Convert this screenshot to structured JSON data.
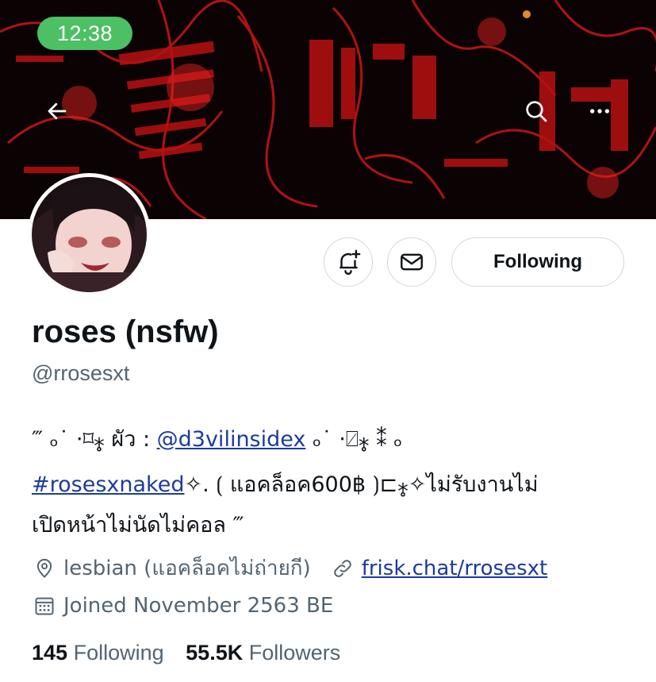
{
  "status_bar": {
    "time": "12:38"
  },
  "header": {
    "back_icon": "arrow-left-icon",
    "search_icon": "search-icon",
    "more_icon": "more-horizontal-icon"
  },
  "colors": {
    "banner_red": "#c41414",
    "banner_dark": "#0b0303",
    "link": "#1d3b9a",
    "secondary_text": "#536471",
    "status_pill": "#4cc063"
  },
  "actions": {
    "notify_icon": "bell-plus-icon",
    "message_icon": "envelope-icon",
    "following_label": "Following"
  },
  "profile": {
    "display_name": "roses (nsfw)",
    "handle": "@rrosesxt",
    "bio": {
      "line1_prefix": "‴ ₒ˙ ⋅⌑⁎̥ ผัว : ",
      "line1_mention": "@d3vilinsidex",
      "line1_suffix": " ₒ˙ ⋅⍁⁎̥ ⁑ ₒ",
      "line2_hashtag": "#rosesxnaked",
      "line2_suffix": "✧. ⟮ แอคล็อค600฿ ⟯⊏⁎̥✧ไม่รับงานไม่",
      "line3": "เปิดหน้าไม่นัดไม่คอล ‴"
    },
    "location": "lesbian (แอคล็อคไม่ถ่ายกี)",
    "location_icon": "location-pin-icon",
    "website": "frisk.chat/rrosesxt",
    "website_icon": "link-icon",
    "joined": "Joined November 2563 BE",
    "joined_icon": "calendar-icon"
  },
  "stats": {
    "following_count": "145",
    "following_label": "Following",
    "followers_count": "55.5K",
    "followers_label": "Followers"
  }
}
